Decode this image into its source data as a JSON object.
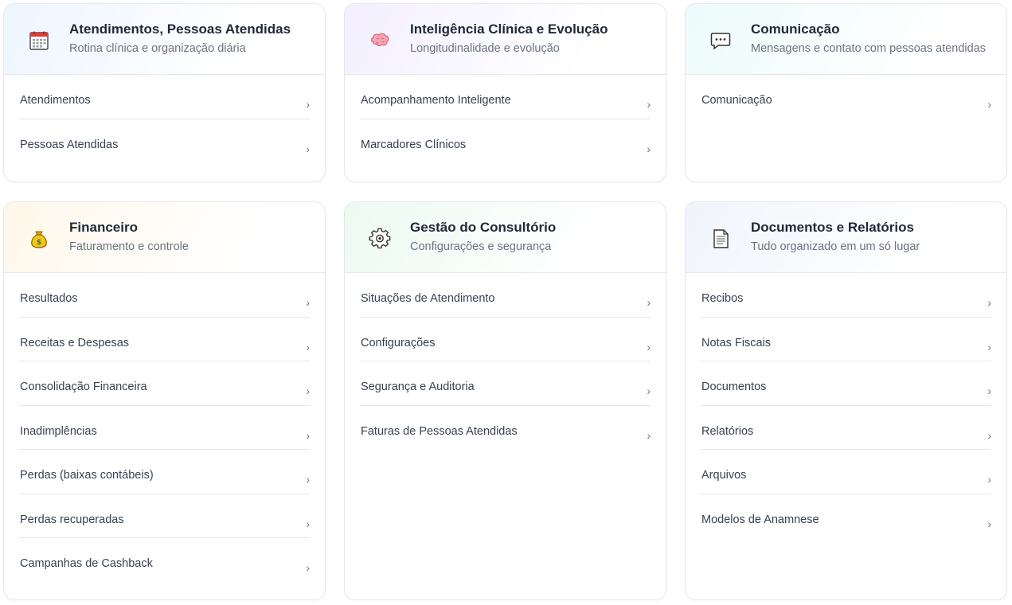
{
  "cards": [
    {
      "title": "Atendimentos, Pessoas Atendidas",
      "subtitle": "Rotina clínica e organização diária",
      "icon": "calendar-icon",
      "gradient": "#eef5ff",
      "items": [
        {
          "label": "Atendimentos"
        },
        {
          "label": "Pessoas Atendidas"
        }
      ]
    },
    {
      "title": "Inteligência Clínica e Evolução",
      "subtitle": "Longitudinalidade e evolução",
      "icon": "brain-icon",
      "gradient": "#f3efff",
      "items": [
        {
          "label": "Acompanhamento Inteligente"
        },
        {
          "label": "Marcadores Clínicos"
        }
      ]
    },
    {
      "title": "Comunicação",
      "subtitle": "Mensagens e contato com pessoas atendidas",
      "icon": "chat-icon",
      "gradient": "#ecfbfb",
      "items": [
        {
          "label": "Comunicação"
        }
      ]
    },
    {
      "title": "Financeiro",
      "subtitle": "Faturamento e controle",
      "icon": "money-bag-icon",
      "gradient": "#fff8ea",
      "items": [
        {
          "label": "Resultados"
        },
        {
          "label": "Receitas e Despesas"
        },
        {
          "label": "Consolidação Financeira"
        },
        {
          "label": "Inadimplências"
        },
        {
          "label": "Perdas (baixas contábeis)"
        },
        {
          "label": "Perdas recuperadas"
        },
        {
          "label": "Campanhas de Cashback"
        }
      ]
    },
    {
      "title": "Gestão do Consultório",
      "subtitle": "Configurações e segurança",
      "icon": "gear-icon",
      "gradient": "#ecfaf2",
      "items": [
        {
          "label": "Situações de Atendimento"
        },
        {
          "label": "Configurações"
        },
        {
          "label": "Segurança e Auditoria"
        },
        {
          "label": "Faturas de Pessoas Atendidas"
        }
      ]
    },
    {
      "title": "Documentos e Relatórios",
      "subtitle": "Tudo organizado em um só lugar",
      "icon": "document-icon",
      "gradient": "#f0f4fb",
      "items": [
        {
          "label": "Recibos"
        },
        {
          "label": "Notas Fiscais"
        },
        {
          "label": "Documentos"
        },
        {
          "label": "Relatórios"
        },
        {
          "label": "Arquivos"
        },
        {
          "label": "Modelos de Anamnese"
        }
      ]
    }
  ],
  "chevron": "›"
}
